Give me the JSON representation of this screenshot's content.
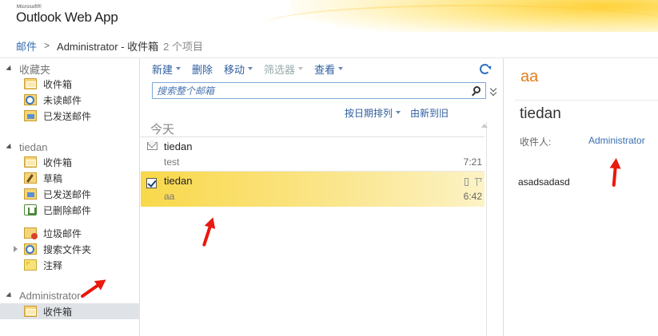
{
  "app": {
    "brand_small": "Microsoft®",
    "brand_name": "Outlook Web App"
  },
  "breadcrumb": {
    "root": "邮件",
    "current": "Administrator - 收件箱",
    "count": "2 个项目"
  },
  "nav": {
    "favorites": {
      "title": "收藏夹",
      "items": [
        {
          "label": "收件箱",
          "icon": "inbox-icon"
        },
        {
          "label": "未读邮件",
          "icon": "search-folder-icon"
        },
        {
          "label": "已发送邮件",
          "icon": "sent-icon"
        }
      ]
    },
    "tiedan": {
      "title": "tiedan",
      "items": [
        {
          "label": "收件箱",
          "icon": "inbox-icon"
        },
        {
          "label": "草稿",
          "icon": "drafts-icon"
        },
        {
          "label": "已发送邮件",
          "icon": "sent-icon"
        },
        {
          "label": "已删除邮件",
          "icon": "deleted-icon"
        },
        {
          "label": "垃圾邮件",
          "icon": "junk-icon"
        },
        {
          "label": "搜索文件夹",
          "icon": "search-folder-icon"
        },
        {
          "label": "注释",
          "icon": "notes-icon"
        }
      ]
    },
    "administrator": {
      "title": "Administrator",
      "items": [
        {
          "label": "收件箱",
          "icon": "inbox-icon",
          "selected": true
        }
      ]
    }
  },
  "toolbar": {
    "new_label": "新建",
    "delete_label": "删除",
    "move_label": "移动",
    "filter_label": "筛选器",
    "view_label": "查看"
  },
  "search": {
    "placeholder": "搜索整个邮箱"
  },
  "sort": {
    "by_label": "按日期排列",
    "order_label": "由新到旧"
  },
  "list": {
    "group_title": "今天",
    "messages": [
      {
        "sender": "tiedan",
        "subject": "test",
        "time": "7:21",
        "selected": false
      },
      {
        "sender": "tiedan",
        "subject": "aa",
        "time": "6:42",
        "selected": true
      }
    ]
  },
  "reading": {
    "subject": "aa",
    "from": "tiedan",
    "to_label": "收件人:",
    "to_value": "Administrator",
    "body": "asadsadasd"
  },
  "colors": {
    "accent": "#3a6fb0",
    "subject": "#e47d1c",
    "selection": "#f9d84a",
    "annotation_arrow": "#e8190f"
  }
}
